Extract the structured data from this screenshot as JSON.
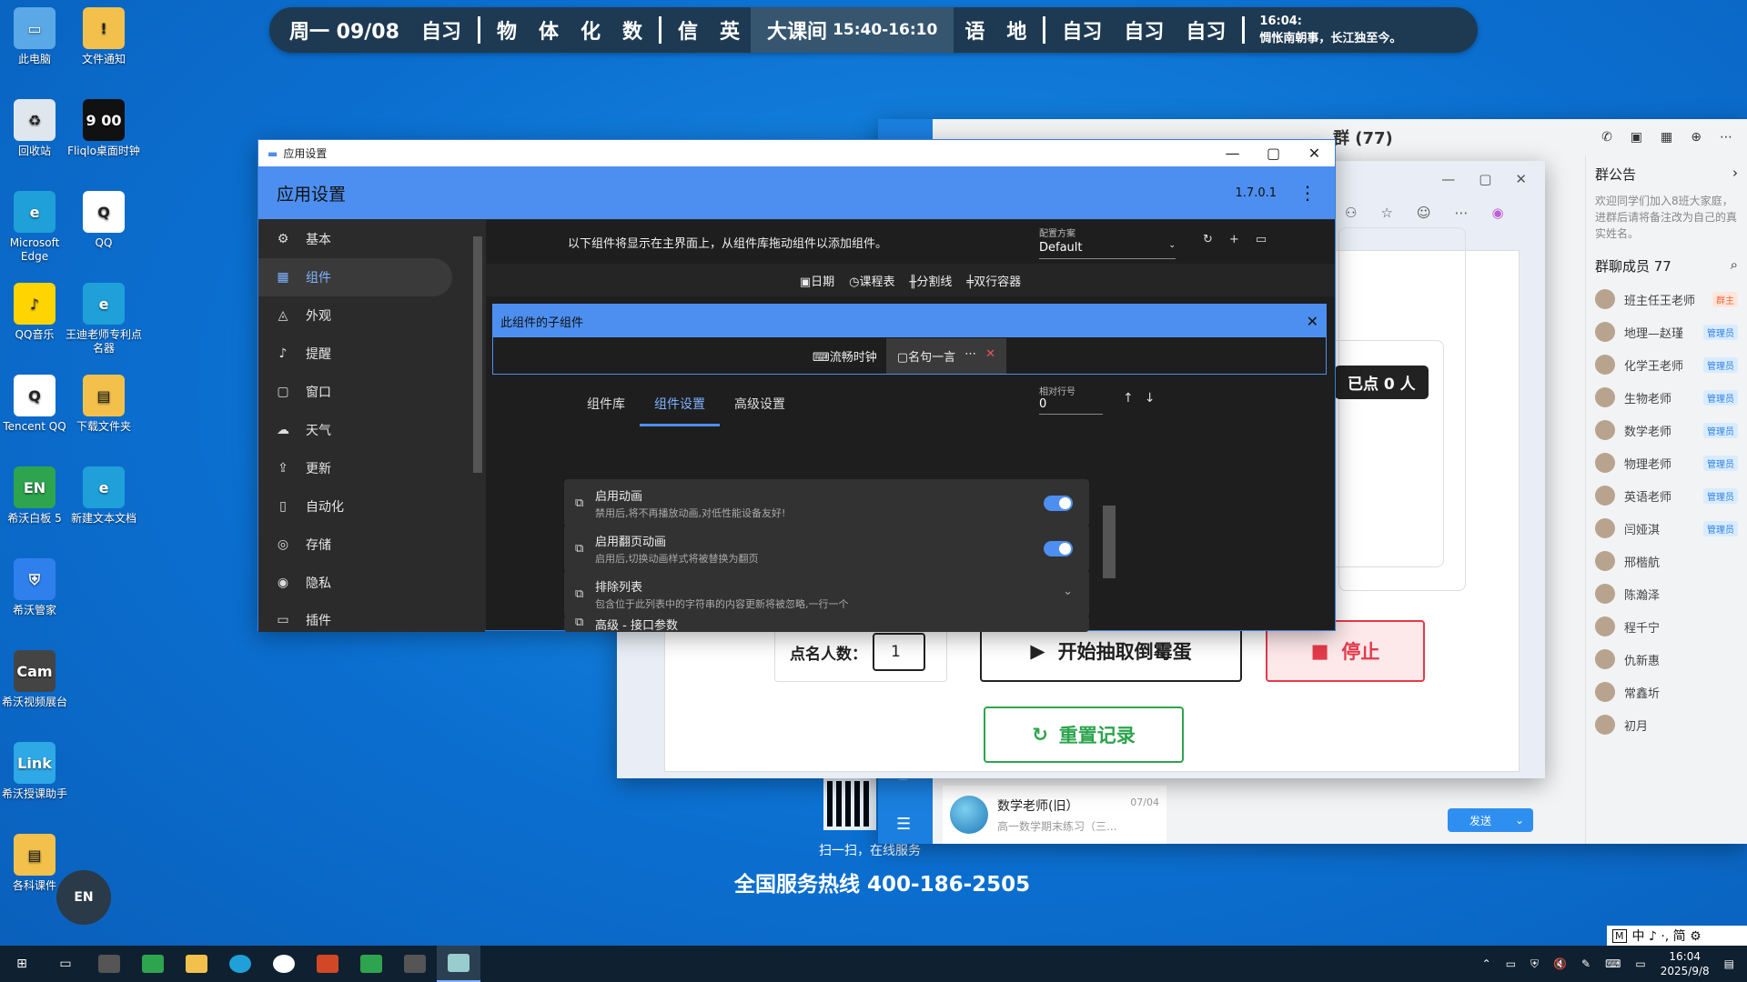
{
  "desktop_icons": [
    {
      "label": "此电脑",
      "icon": "computer-icon",
      "color": "#5aa9e6",
      "glyph": "▭"
    },
    {
      "label": "文件通知",
      "icon": "folder-warning-icon",
      "color": "#f3c14b",
      "glyph": "!"
    },
    {
      "label": "回收站",
      "icon": "recycle-bin-icon",
      "color": "#dfe6ee",
      "glyph": "♻"
    },
    {
      "label": "Fliqlo桌面时钟",
      "icon": "flip-clock-icon",
      "color": "#111111",
      "glyph": "9 00"
    },
    {
      "label": "Microsoft Edge",
      "icon": "edge-icon",
      "color": "#1fa0d8",
      "glyph": "e"
    },
    {
      "label": "QQ",
      "icon": "qq-icon",
      "color": "#ffffff",
      "glyph": "Q"
    },
    {
      "label": "QQ音乐",
      "icon": "qq-music-icon",
      "color": "#ffd400",
      "glyph": "♪"
    },
    {
      "label": "王迪老师专利点名器",
      "icon": "edge-icon",
      "color": "#1fa0d8",
      "glyph": "e"
    },
    {
      "label": "Tencent QQ",
      "icon": "qq-icon",
      "color": "#ffffff",
      "glyph": "Q"
    },
    {
      "label": "下载文件夹",
      "icon": "folder-icon",
      "color": "#f3c14b",
      "glyph": "▤"
    },
    {
      "label": "希沃白板 5",
      "icon": "seewo-board-icon",
      "color": "#2ea44f",
      "glyph": "EN"
    },
    {
      "label": "新建文本文档",
      "icon": "edge-icon",
      "color": "#1fa0d8",
      "glyph": "e"
    },
    {
      "label": "希沃管家",
      "icon": "shield-icon",
      "color": "#2f80ed",
      "glyph": "⛨"
    },
    {
      "label": "希沃视频展台",
      "icon": "camera-icon",
      "color": "#444444",
      "glyph": "Cam"
    },
    {
      "label": "希沃授课助手",
      "icon": "link-icon",
      "color": "#2fa8e6",
      "glyph": "Link"
    },
    {
      "label": "各科课件",
      "icon": "folder-icon",
      "color": "#f3c14b",
      "glyph": "▤"
    }
  ],
  "schedule": {
    "date": "周一 09/08",
    "items": [
      "自习",
      "物",
      "体",
      "化",
      "数",
      "信",
      "英"
    ],
    "current_label": "大课间",
    "current_time": "15:40-16:10",
    "after": [
      "语",
      "地",
      "自习",
      "自习",
      "自习"
    ],
    "time": "16:04:",
    "quote": "惆怅南朝事，长江独至今。"
  },
  "settings": {
    "window_title": "应用设置",
    "app_title": "应用设置",
    "version": "1.7.0.1",
    "nav": [
      {
        "label": "基本",
        "icon": "gear-icon",
        "glyph": "⚙"
      },
      {
        "label": "组件",
        "icon": "grid-icon",
        "glyph": "▦"
      },
      {
        "label": "外观",
        "icon": "palette-icon",
        "glyph": "◬"
      },
      {
        "label": "提醒",
        "icon": "bell-icon",
        "glyph": "♪"
      },
      {
        "label": "窗口",
        "icon": "window-icon",
        "glyph": "▢"
      },
      {
        "label": "天气",
        "icon": "cloud-icon",
        "glyph": "☁"
      },
      {
        "label": "更新",
        "icon": "upload-icon",
        "glyph": "⇪"
      },
      {
        "label": "自动化",
        "icon": "automation-icon",
        "glyph": "▯"
      },
      {
        "label": "存储",
        "icon": "database-icon",
        "glyph": "◎"
      },
      {
        "label": "隐私",
        "icon": "privacy-icon",
        "glyph": "◉"
      },
      {
        "label": "插件",
        "icon": "plugin-icon",
        "glyph": "▭"
      }
    ],
    "hint": "以下组件将显示在主界面上，从组件库拖动组件以添加组件。",
    "profile_label": "配置方案",
    "profile_value": "Default",
    "components": [
      "日期",
      "课程表",
      "分割线",
      "双行容器"
    ],
    "component_icons": [
      "▣",
      "◷",
      "╫",
      "╪"
    ],
    "sub_title": "此组件的子组件",
    "sub_items": [
      "流畅时钟",
      "名句一言"
    ],
    "tabs": [
      "组件库",
      "组件设置",
      "高级设置"
    ],
    "row_label": "相对行号",
    "row_value": "0",
    "cards": [
      {
        "title": "启用动画",
        "desc": "禁用后,将不再播放动画,对低性能设备友好!",
        "toggle": true
      },
      {
        "title": "启用翻页动画",
        "desc": "启用后,切换动画样式将被替换为翻页",
        "toggle": true
      },
      {
        "title": "排除列表",
        "desc": "包含位于此列表中的字符串的内容更新将被忽略,一行一个",
        "toggle": false
      },
      {
        "title": "高级 - 接口参数",
        "desc": "",
        "toggle": false
      }
    ]
  },
  "picker": {
    "count_label": "点名人数：",
    "count_value": "1",
    "start_label": "开始抽取倒霉蛋",
    "stop_label": "停止",
    "reset_label": "重置记录",
    "called_label": "已点 0 人"
  },
  "qq": {
    "title_suffix": "群 (77)",
    "notice_title": "群公告",
    "notice_text": "欢迎同学们加入8班大家庭，进群后请将备注改为自己的真实姓名。",
    "members_title": "群聊成员 77",
    "members": [
      {
        "name": "班主任王老师",
        "role": "群主",
        "owner": true
      },
      {
        "name": "地理—赵瑾",
        "role": "管理员"
      },
      {
        "name": "化学王老师",
        "role": "管理员"
      },
      {
        "name": "生物老师",
        "role": "管理员"
      },
      {
        "name": "数学老师",
        "role": "管理员"
      },
      {
        "name": "物理老师",
        "role": "管理员"
      },
      {
        "name": "英语老师",
        "role": "管理员"
      },
      {
        "name": "闫娅淇",
        "role": "管理员"
      },
      {
        "name": "邢楷航",
        "role": ""
      },
      {
        "name": "陈瀚泽",
        "role": ""
      },
      {
        "name": "程千宁",
        "role": ""
      },
      {
        "name": "仇新惠",
        "role": ""
      },
      {
        "name": "常鑫圻",
        "role": ""
      },
      {
        "name": "初月",
        "role": ""
      }
    ],
    "send_label": "发送",
    "chat_name": "数学老师(旧）",
    "chat_date": "07/04",
    "chat_preview": "高一数学期末练习（三..."
  },
  "wallpaper": {
    "scan_text": "扫一扫，在线服务",
    "hotline": "全国服务热线 400-186-2505"
  },
  "taskbar": {
    "time": "16:04",
    "date": "2025/9/8",
    "ime": "中 ♪ ·, 简 ⚙"
  }
}
